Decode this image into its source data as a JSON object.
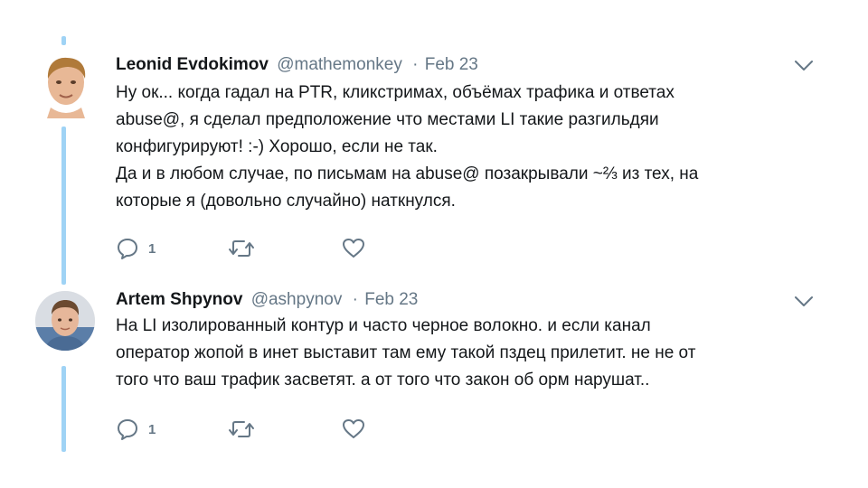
{
  "tweets": [
    {
      "name": "Leonid Evdokimov",
      "handle": "@mathemonkey",
      "separator": "·",
      "date": "Feb 23",
      "text_lines": [
        "Ну ок... когда гадал на PTR, кликстримах, объёмах трафика и ответах",
        "abuse@, я сделал предположение что местами LI такие разгильдяи",
        "конфигурируют! :-) Хорошо, если не так.",
        "Да и в любом случае, по письмам на abuse@ позакрывали ~⅔ из тех, на",
        "которые я (довольно случайно) наткнулся."
      ],
      "reply_count": "1",
      "icons": {
        "reply": "reply-icon",
        "retweet": "retweet-icon",
        "like": "heart-icon",
        "menu": "chevron-down-icon"
      }
    },
    {
      "name": "Artem Shpynov",
      "handle": "@ashpynov",
      "separator": "·",
      "date": "Feb 23",
      "text_lines": [
        "На LI изолированный контур и часто черное волокно. и если канал",
        "оператор жопой в инет выставит там ему такой пздец прилетит. не не от",
        "того что ваш трафик засветят. а от того что закон об орм нарушат.."
      ],
      "reply_count": "1",
      "icons": {
        "reply": "reply-icon",
        "retweet": "retweet-icon",
        "like": "heart-icon",
        "menu": "chevron-down-icon"
      }
    }
  ],
  "colors": {
    "thread_line": "#9fd3f5",
    "muted": "#657786",
    "text": "#14171a"
  }
}
